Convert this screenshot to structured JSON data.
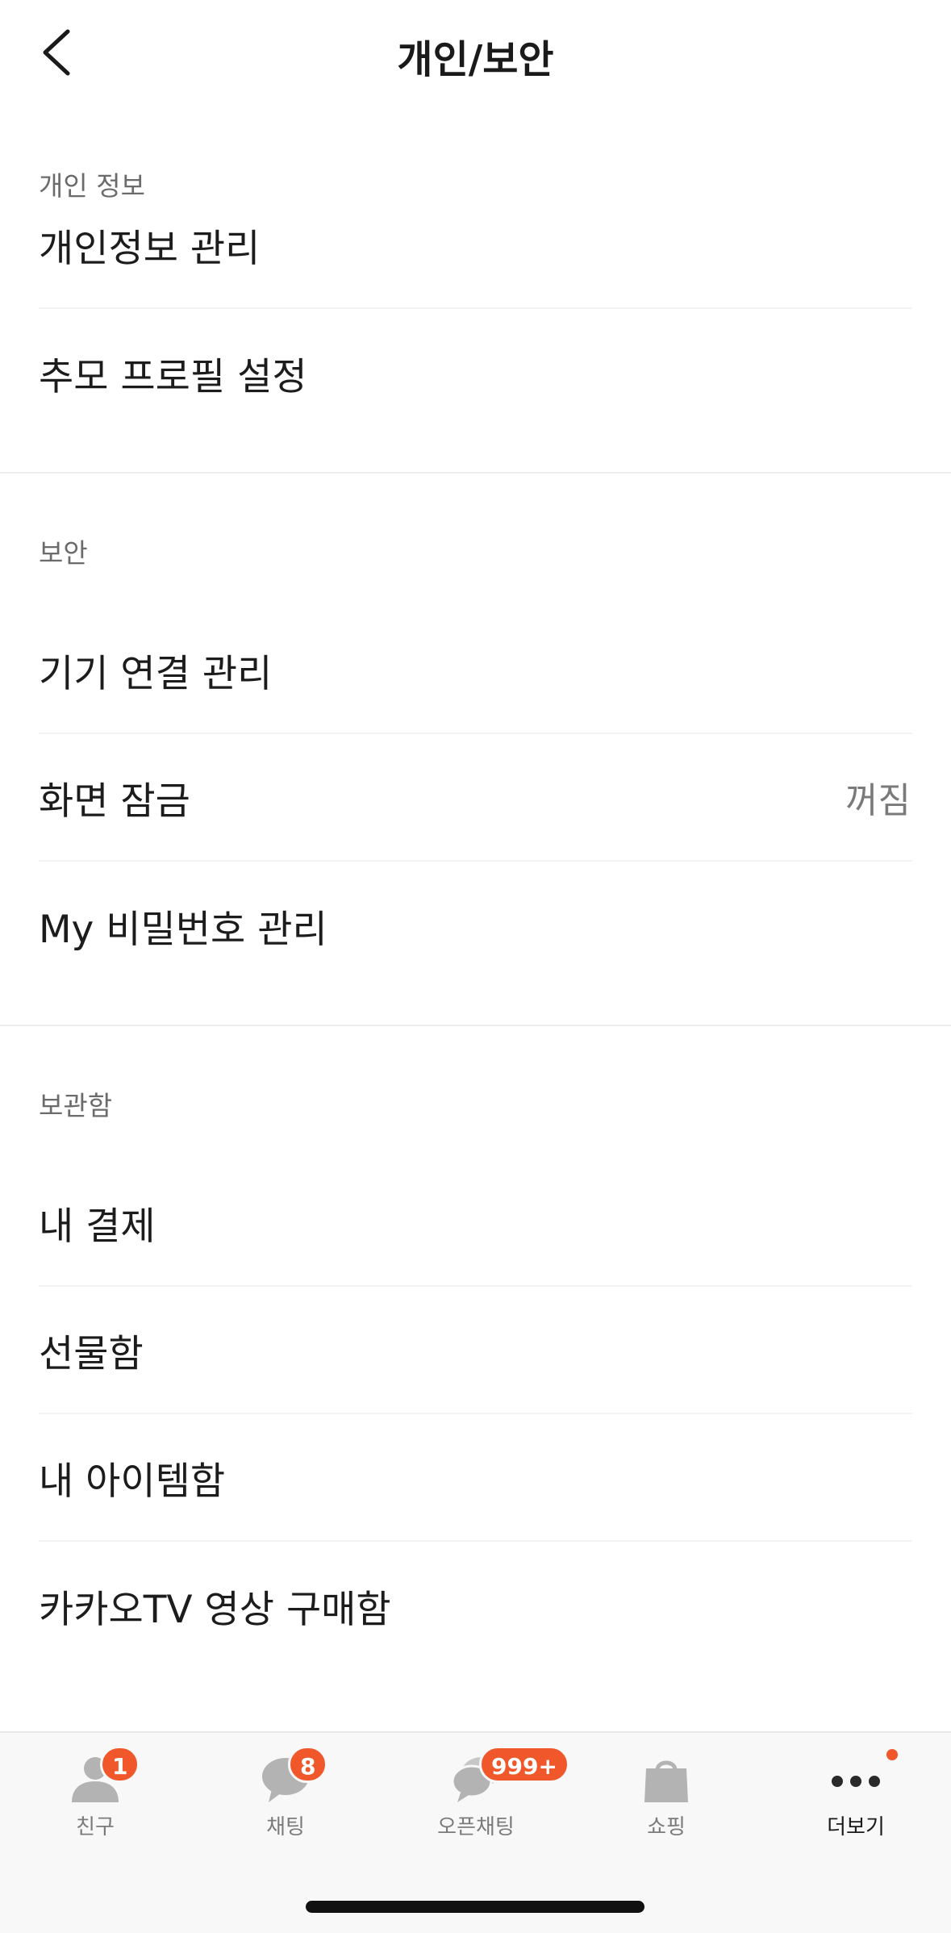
{
  "header": {
    "title": "개인/보안"
  },
  "sections": {
    "personal": {
      "title": "개인 정보",
      "items": [
        {
          "label": "개인정보 관리"
        },
        {
          "label": "추모 프로필 설정"
        }
      ]
    },
    "security": {
      "title": "보안",
      "items": [
        {
          "label": "기기 연결 관리"
        },
        {
          "label": "화면 잠금",
          "value": "꺼짐"
        },
        {
          "label": "My 비밀번호 관리"
        }
      ]
    },
    "storage": {
      "title": "보관함",
      "items": [
        {
          "label": "내 결제"
        },
        {
          "label": "선물함"
        },
        {
          "label": "내 아이템함"
        },
        {
          "label": "카카오TV 영상 구매함"
        }
      ]
    }
  },
  "tabbar": {
    "tabs": [
      {
        "label": "친구",
        "icon": "person-icon",
        "badge": "1"
      },
      {
        "label": "채팅",
        "icon": "chat-bubble-icon",
        "badge": "8"
      },
      {
        "label": "오픈채팅",
        "icon": "open-chat-icon",
        "badge": "999+"
      },
      {
        "label": "쇼핑",
        "icon": "shopping-bag-icon"
      },
      {
        "label": "더보기",
        "icon": "more-dots-icon",
        "active": true,
        "dot": true
      }
    ]
  },
  "colors": {
    "badge": "#f0572a",
    "tab_icon": "#b3b3b3",
    "active": "#1a1a1a"
  }
}
